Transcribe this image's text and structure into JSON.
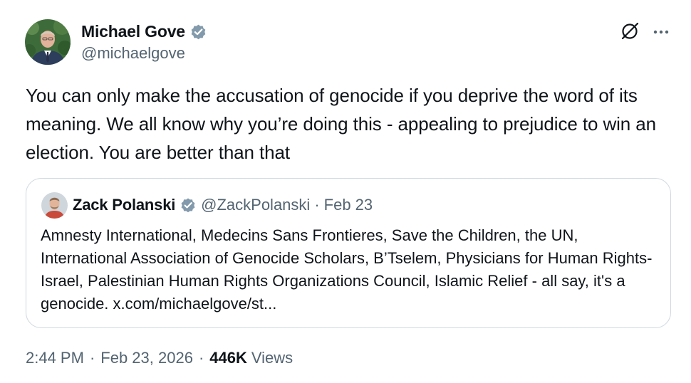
{
  "colors": {
    "text_primary": "#0f1419",
    "text_secondary": "#536471",
    "verified_badge": "#829aab",
    "border": "#cfd9de"
  },
  "tweet": {
    "author": {
      "name": "Michael Gove",
      "handle": "@michaelgove",
      "verified_icon": "verified-badge-icon",
      "avatar_icon": "avatar"
    },
    "actions": {
      "grok_icon": "grok-icon",
      "more_icon": "more-options-icon"
    },
    "text": "You can only make the accusation of genocide if you deprive the word of its meaning. We all know why you’re doing this - appealing to prejudice to win an election. You are better than that",
    "quote": {
      "author_name": "Zack Polanski",
      "handle": "@ZackPolanski",
      "separator": "·",
      "date": "Feb 23",
      "text": "Amnesty International, Medecins Sans Frontieres, Save the Children, the UN, International Association of Genocide Scholars, B’Tselem, Physicians for Human Rights-Israel, Palestinian Human Rights Organizations Council, Islamic Relief - all say, it's a genocide. x.com/michaelgove/st..."
    },
    "meta": {
      "time": "2:44 PM",
      "separator": "·",
      "date": "Feb 23, 2026",
      "views_count": "446K",
      "views_label": "Views"
    }
  }
}
